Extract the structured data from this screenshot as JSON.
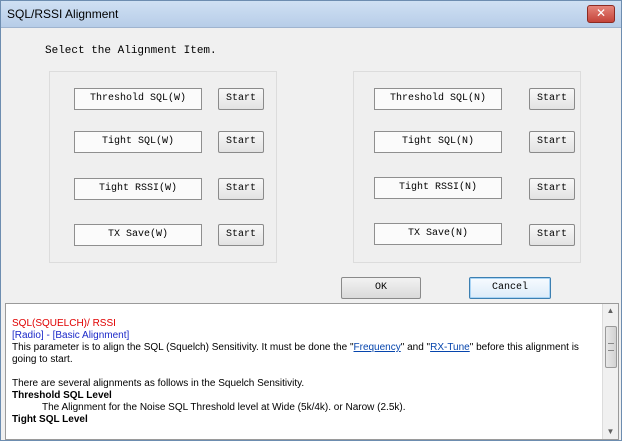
{
  "window": {
    "title": "SQL/RSSI Alignment",
    "close_glyph": "✕"
  },
  "prompt": "Select the Alignment Item.",
  "left_group": [
    {
      "label": "Threshold SQL(W)",
      "button": "Start"
    },
    {
      "label": "Tight SQL(W)",
      "button": "Start"
    },
    {
      "label": "Tight RSSI(W)",
      "button": "Start"
    },
    {
      "label": "TX Save(W)",
      "button": "Start"
    }
  ],
  "right_group": [
    {
      "label": "Threshold SQL(N)",
      "button": "Start"
    },
    {
      "label": "Tight SQL(N)",
      "button": "Start"
    },
    {
      "label": "Tight RSSI(N)",
      "button": "Start"
    },
    {
      "label": "TX Save(N)",
      "button": "Start"
    }
  ],
  "buttons": {
    "ok": "OK",
    "cancel": "Cancel"
  },
  "help": {
    "heading": "SQL(SQUELCH)/ RSSI",
    "breadcrumb": "[Radio] - [Basic Alignment]",
    "para1_before": "This parameter is to align the SQL (Squelch) Sensitivity. It must be done the \"",
    "link1": "Frequency",
    "para1_mid": "\" and \"",
    "link2": "RX-Tune",
    "para1_after": "\" before this alignment is going to start.",
    "para2": "There are several alignments as follows in the Squelch Sensitivity.",
    "section1_title": "Threshold SQL Level",
    "section1_text": "The Alignment for the Noise SQL Threshold level at Wide (5k/4k). or Narow (2.5k).",
    "section2_title": "Tight SQL Level"
  },
  "scrollbar": {
    "up_glyph": "▲",
    "down_glyph": "▼"
  },
  "colors": {
    "heading_red": "#e00000",
    "breadcrumb_blue": "#1a28c8",
    "link_blue": "#0645ad",
    "default_button_border": "#3c7fb1"
  }
}
